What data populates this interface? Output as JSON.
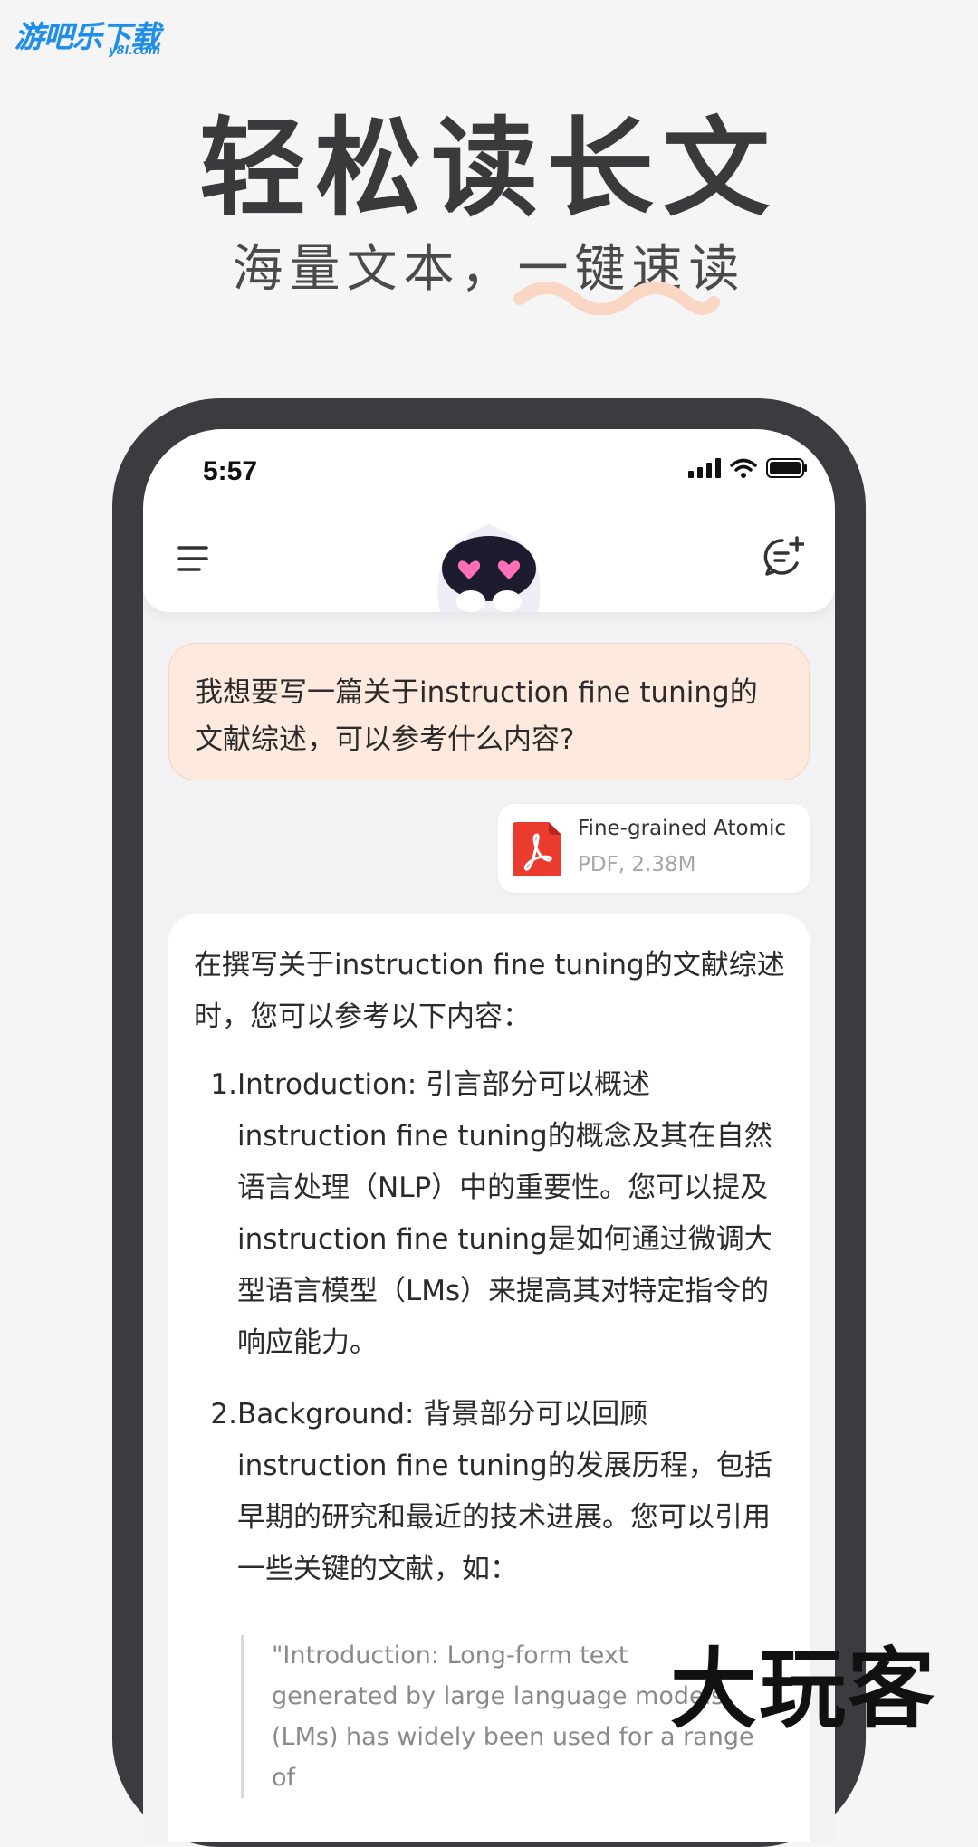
{
  "site_logo": {
    "text": "游吧乐下载",
    "sub": "y8l.com"
  },
  "hero": {
    "title": "轻松读长文",
    "subtitle": "海量文本，一键速读"
  },
  "status_bar": {
    "time": "5:57"
  },
  "chat": {
    "user_message": "我想要写一篇关于instruction fine tuning的文献综述，可以参考什么内容?",
    "file": {
      "name": "Fine-grained Atomic",
      "meta": "PDF, 2.38M"
    },
    "answer": {
      "intro": "在撰写关于instruction fine tuning的文献综述时，您可以参考以下内容：",
      "items": [
        {
          "num": "1.",
          "text": " Introduction: 引言部分可以概述instruction fine tuning的概念及其在自然语言处理（NLP）中的重要性。您可以提及instruction fine tuning是如何通过微调大型语言模型（LMs）来提高其对特定指令的响应能力。"
        },
        {
          "num": "2.",
          "text": "Background: 背景部分可以回顾instruction fine tuning的发展历程，包括早期的研究和最近的技术进展。您可以引用一些关键的文献，如："
        }
      ],
      "quote": "\"Introduction: Long-form text generated by large language models (LMs) has widely been used for a range of"
    }
  },
  "watermark": "大玩客",
  "colors": {
    "accent_squiggle": "#fad7c5",
    "user_bubble": "#fde9dd",
    "pdf_red": "#ea3b2e"
  }
}
